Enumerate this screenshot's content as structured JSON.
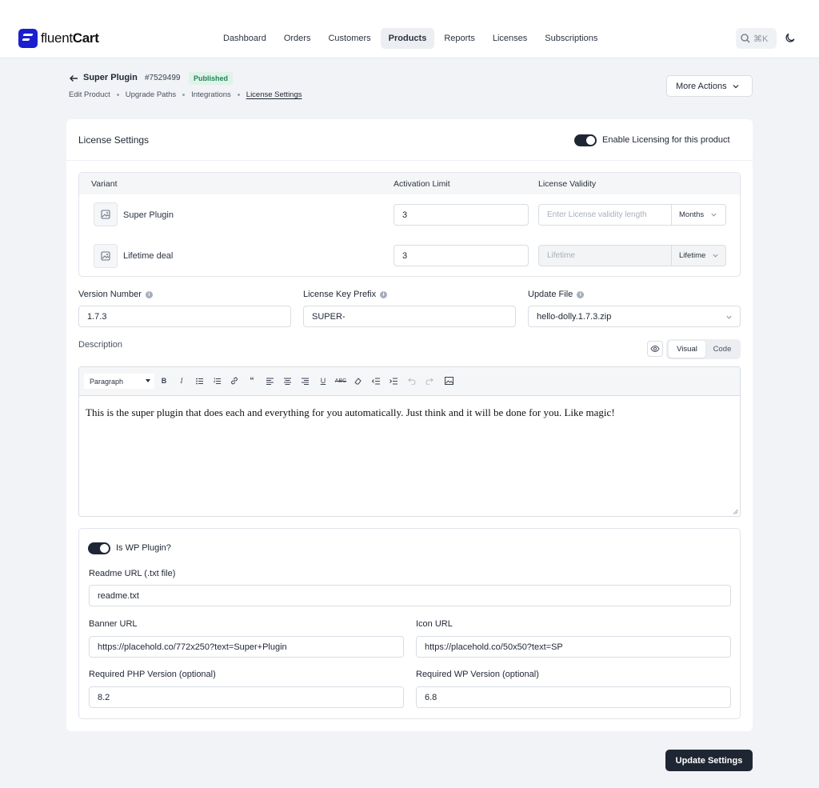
{
  "brand": {
    "name_light": "fluent",
    "name_bold": "Cart"
  },
  "nav": {
    "items": [
      {
        "label": "Dashboard"
      },
      {
        "label": "Orders"
      },
      {
        "label": "Customers"
      },
      {
        "label": "Products"
      },
      {
        "label": "Reports"
      },
      {
        "label": "Licenses"
      },
      {
        "label": "Subscriptions"
      }
    ],
    "active": "Products",
    "search_shortcut": "⌘K"
  },
  "product": {
    "title": "Super Plugin",
    "id": "#7529499",
    "status": "Published",
    "status_color": "#23845a"
  },
  "breadcrumbs": [
    "Edit Product",
    "Upgrade Paths",
    "Integrations",
    "License Settings"
  ],
  "more_actions": "More Actions",
  "license": {
    "title": "License Settings",
    "enable_label": "Enable Licensing for this product",
    "enabled": true,
    "columns": {
      "variant": "Variant",
      "activation": "Activation Limit",
      "validity": "License Validity"
    },
    "variants": [
      {
        "name": "Super Plugin",
        "activation_limit": "3",
        "validity_placeholder": "Enter License validity length",
        "validity_unit": "Months"
      },
      {
        "name": "Lifetime deal",
        "activation_limit": "3",
        "validity_placeholder": "Lifetime",
        "validity_unit": "Lifetime"
      }
    ],
    "version_label": "Version Number",
    "version_value": "1.7.3",
    "prefix_label": "License Key Prefix",
    "prefix_value": "SUPER-",
    "update_file_label": "Update File",
    "update_file_value": "hello-dolly.1.7.3.zip",
    "description_label": "Description",
    "editor_tabs": [
      "Visual",
      "Code"
    ],
    "editor_active_tab": "Visual",
    "format_select": "Paragraph",
    "description_text": "This is the super plugin that does each and everything for you automatically. Just think and it will be done for you. Like magic!"
  },
  "wp": {
    "toggle_label": "Is WP Plugin?",
    "enabled": true,
    "readme_label": "Readme URL (.txt file)",
    "readme_value": "readme.txt",
    "banner_label": "Banner URL",
    "banner_value": "https://placehold.co/772x250?text=Super+Plugin",
    "icon_label": "Icon URL",
    "icon_value": "https://placehold.co/50x50?text=SP",
    "php_label": "Required PHP Version (optional)",
    "php_value": "8.2",
    "wpver_label": "Required WP Version (optional)",
    "wpver_value": "6.8"
  },
  "update_button": "Update Settings",
  "colors": {
    "brand": "#1a1fcf",
    "dark": "#1f2633",
    "page_bg": "#f1f3f6"
  }
}
